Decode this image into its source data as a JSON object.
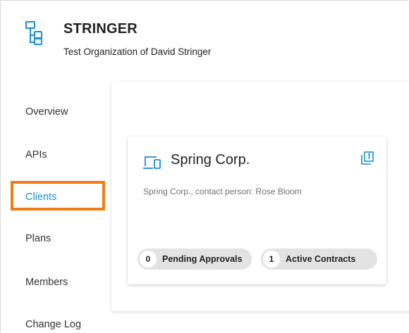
{
  "organization": {
    "name": "STRINGER",
    "description": "Test Organization of David Stringer",
    "icon": "org-tree-icon"
  },
  "nav": {
    "items": [
      {
        "label": "Overview"
      },
      {
        "label": "APIs"
      },
      {
        "label": "Clients",
        "active": true
      },
      {
        "label": "Plans"
      },
      {
        "label": "Members"
      },
      {
        "label": "Change Log"
      }
    ]
  },
  "client_card": {
    "name": "Spring Corp.",
    "description": "Spring Corp., contact person: Rose Bloom",
    "client_icon": "devices-icon",
    "copy_icon": "copy-icon",
    "pending_approvals": {
      "count": "0",
      "label": "Pending Approvals"
    },
    "active_contracts": {
      "count": "1",
      "label": "Active Contracts"
    }
  },
  "colors": {
    "accent": "#1a8dd3",
    "highlight": "#ee7d14",
    "chip_bg": "#e3e3e3"
  }
}
